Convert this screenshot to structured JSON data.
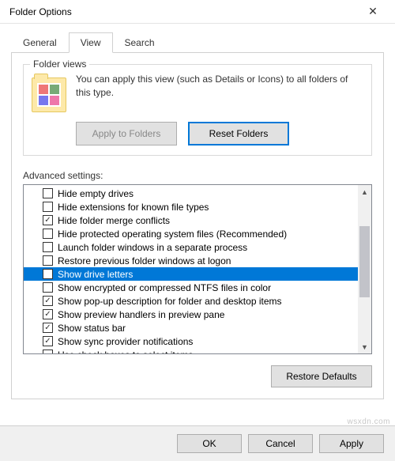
{
  "window": {
    "title": "Folder Options"
  },
  "tabs": {
    "general": "General",
    "view": "View",
    "search": "Search",
    "active": "view"
  },
  "folder_views": {
    "legend": "Folder views",
    "text": "You can apply this view (such as Details or Icons) to all folders of this type.",
    "apply_btn": "Apply to Folders",
    "reset_btn": "Reset Folders"
  },
  "advanced": {
    "label": "Advanced settings:",
    "items": [
      {
        "label": "Hide empty drives",
        "checked": false,
        "selected": false
      },
      {
        "label": "Hide extensions for known file types",
        "checked": false,
        "selected": false
      },
      {
        "label": "Hide folder merge conflicts",
        "checked": true,
        "selected": false
      },
      {
        "label": "Hide protected operating system files (Recommended)",
        "checked": false,
        "selected": false
      },
      {
        "label": "Launch folder windows in a separate process",
        "checked": false,
        "selected": false
      },
      {
        "label": "Restore previous folder windows at logon",
        "checked": false,
        "selected": false
      },
      {
        "label": "Show drive letters",
        "checked": false,
        "selected": true
      },
      {
        "label": "Show encrypted or compressed NTFS files in color",
        "checked": false,
        "selected": false
      },
      {
        "label": "Show pop-up description for folder and desktop items",
        "checked": true,
        "selected": false
      },
      {
        "label": "Show preview handlers in preview pane",
        "checked": true,
        "selected": false
      },
      {
        "label": "Show status bar",
        "checked": true,
        "selected": false
      },
      {
        "label": "Show sync provider notifications",
        "checked": true,
        "selected": false
      },
      {
        "label": "Use check boxes to select items",
        "checked": false,
        "selected": false
      }
    ],
    "restore_btn": "Restore Defaults"
  },
  "bottom": {
    "ok": "OK",
    "cancel": "Cancel",
    "apply": "Apply"
  },
  "watermark": "wsxdn.com"
}
